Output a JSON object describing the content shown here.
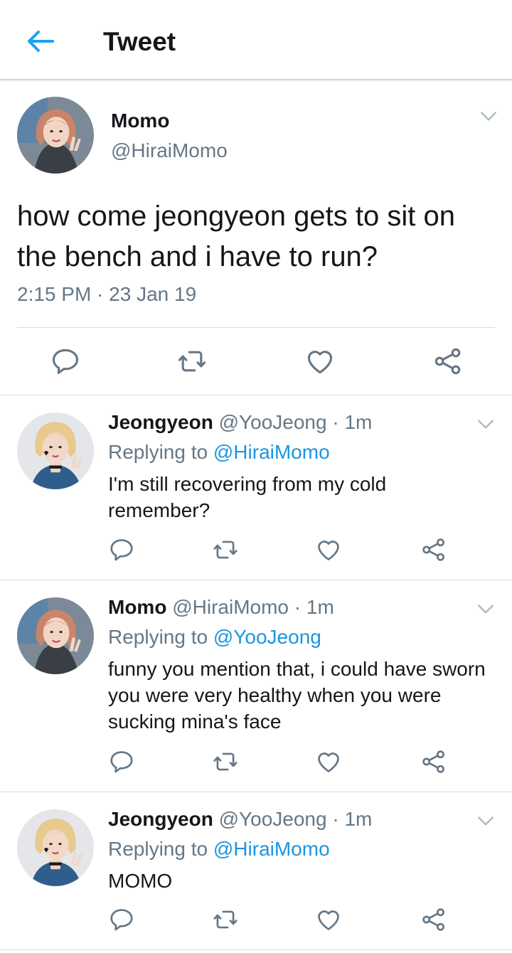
{
  "header": {
    "title": "Tweet"
  },
  "tweet": {
    "name": "Momo",
    "handle": "@HiraiMomo",
    "text": "how come jeongyeon gets to sit on the bench and i have to run?",
    "time": "2:15 PM · 23 Jan 19"
  },
  "replies": [
    {
      "name": "Jeongyeon",
      "meta": "@YooJeong · 1m",
      "replying_prefix": "Replying to",
      "replying_to": "@HiraiMomo",
      "text": "I'm still recovering from my cold remember?"
    },
    {
      "name": "Momo",
      "meta": "@HiraiMomo · 1m",
      "replying_prefix": "Replying to",
      "replying_to": "@YooJeong",
      "text": "funny you mention that, i could have sworn you were very healthy when you were sucking mina's face"
    },
    {
      "name": "Jeongyeon",
      "meta": "@YooJeong · 1m",
      "replying_prefix": "Replying to",
      "replying_to": "@HiraiMomo",
      "text": "MOMO"
    }
  ],
  "colors": {
    "accent": "#1da1f2",
    "link": "#1b95e0",
    "secondary": "#657786",
    "divider": "#d8dde2"
  },
  "icons": [
    "back-arrow-icon",
    "chevron-down-icon",
    "reply-icon",
    "retweet-icon",
    "like-icon",
    "share-icon"
  ]
}
